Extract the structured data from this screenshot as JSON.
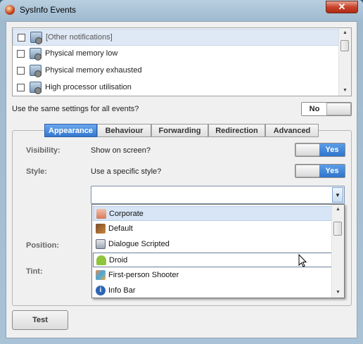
{
  "window": {
    "title": "SysInfo Events",
    "close_glyph": "✕"
  },
  "events": [
    {
      "label": "[Other notifications]",
      "checked": false,
      "selected": true
    },
    {
      "label": "Physical memory low",
      "checked": false,
      "selected": false
    },
    {
      "label": "Physical memory exhausted",
      "checked": false,
      "selected": false
    },
    {
      "label": "High processor utilisation",
      "checked": false,
      "selected": false
    }
  ],
  "same_settings": {
    "label": "Use the same settings for all events?",
    "value": "No"
  },
  "tabs": [
    "Appearance",
    "Behaviour",
    "Forwarding",
    "Redirection",
    "Advanced"
  ],
  "active_tab": "Appearance",
  "form": {
    "visibility": {
      "label": "Visibility:",
      "text": "Show on screen?",
      "value": "Yes"
    },
    "style": {
      "label": "Style:",
      "text": "Use a specific style?",
      "value": "Yes",
      "selected": ""
    },
    "position": {
      "label": "Position:"
    },
    "tint": {
      "label": "Tint:"
    }
  },
  "style_options": [
    {
      "label": "Corporate",
      "icon": "corporate-person-icon",
      "state": "selected"
    },
    {
      "label": "Default",
      "icon": "default-style-icon",
      "state": "normal"
    },
    {
      "label": "Dialogue Scripted",
      "icon": "dialogue-window-icon",
      "state": "normal"
    },
    {
      "label": "Droid",
      "icon": "android-droid-icon",
      "state": "hover"
    },
    {
      "label": "First-person Shooter",
      "icon": "first-person-shooter-icon",
      "state": "normal"
    },
    {
      "label": "Info Bar",
      "icon": "info-icon",
      "state": "normal"
    }
  ],
  "buttons": {
    "test": "Test"
  },
  "colors": {
    "accent": "#3477cf",
    "selection": "#dfe9f5",
    "close": "#c8442c"
  }
}
